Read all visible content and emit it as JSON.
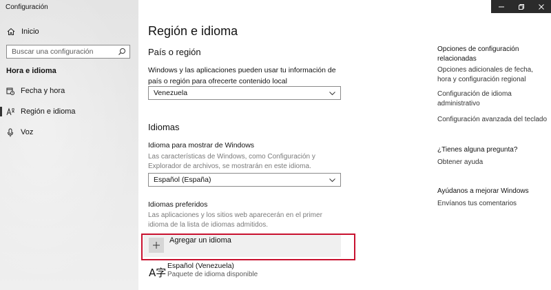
{
  "window": {
    "title": "Configuración",
    "controls": [
      "minimize-icon",
      "restore-icon",
      "close-icon"
    ]
  },
  "sidebar": {
    "home_label": "Inicio",
    "search_placeholder": "Buscar una configuración",
    "section_title": "Hora e idioma",
    "items": [
      {
        "label": "Fecha y hora",
        "icon": "calendar-clock-icon",
        "active": false
      },
      {
        "label": "Región e idioma",
        "icon": "language-icon",
        "active": true
      },
      {
        "label": "Voz",
        "icon": "microphone-icon",
        "active": false
      }
    ]
  },
  "main": {
    "page_title": "Región e idioma",
    "region": {
      "heading": "País o región",
      "description": "Windows y las aplicaciones pueden usar tu información de país o región para ofrecerte contenido local",
      "selected": "Venezuela"
    },
    "languages": {
      "heading": "Idiomas",
      "display_label": "Idioma para mostrar de Windows",
      "display_description": "Las características de Windows, como Configuración y Explorador de archivos, se mostrarán en este idioma.",
      "display_selected": "Español (España)",
      "preferred_label": "Idiomas preferidos",
      "preferred_description": "Las aplicaciones y los sitios web aparecerán en el primer idioma de la lista de idiomas admitidos.",
      "add_language_label": "Agregar un idioma",
      "entries": [
        {
          "name": "Español (Venezuela)",
          "status": "Paquete de idioma disponible"
        }
      ]
    }
  },
  "right": {
    "related_heading": "Opciones de configuración relacionadas",
    "links": [
      "Opciones adicionales de fecha, hora y configuración regional",
      "Configuración de idioma administrativo",
      "Configuración avanzada del teclado"
    ],
    "question_heading": "¿Tienes alguna pregunta?",
    "help_link": "Obtener ayuda",
    "improve_heading": "Ayúdanos a mejorar Windows",
    "feedback_link": "Envíanos tus comentarios"
  },
  "colors": {
    "highlight_border": "#c8102e",
    "titlebar_controls_bg": "#2b2b2b",
    "sidebar_bg": "#e6e6e6"
  }
}
